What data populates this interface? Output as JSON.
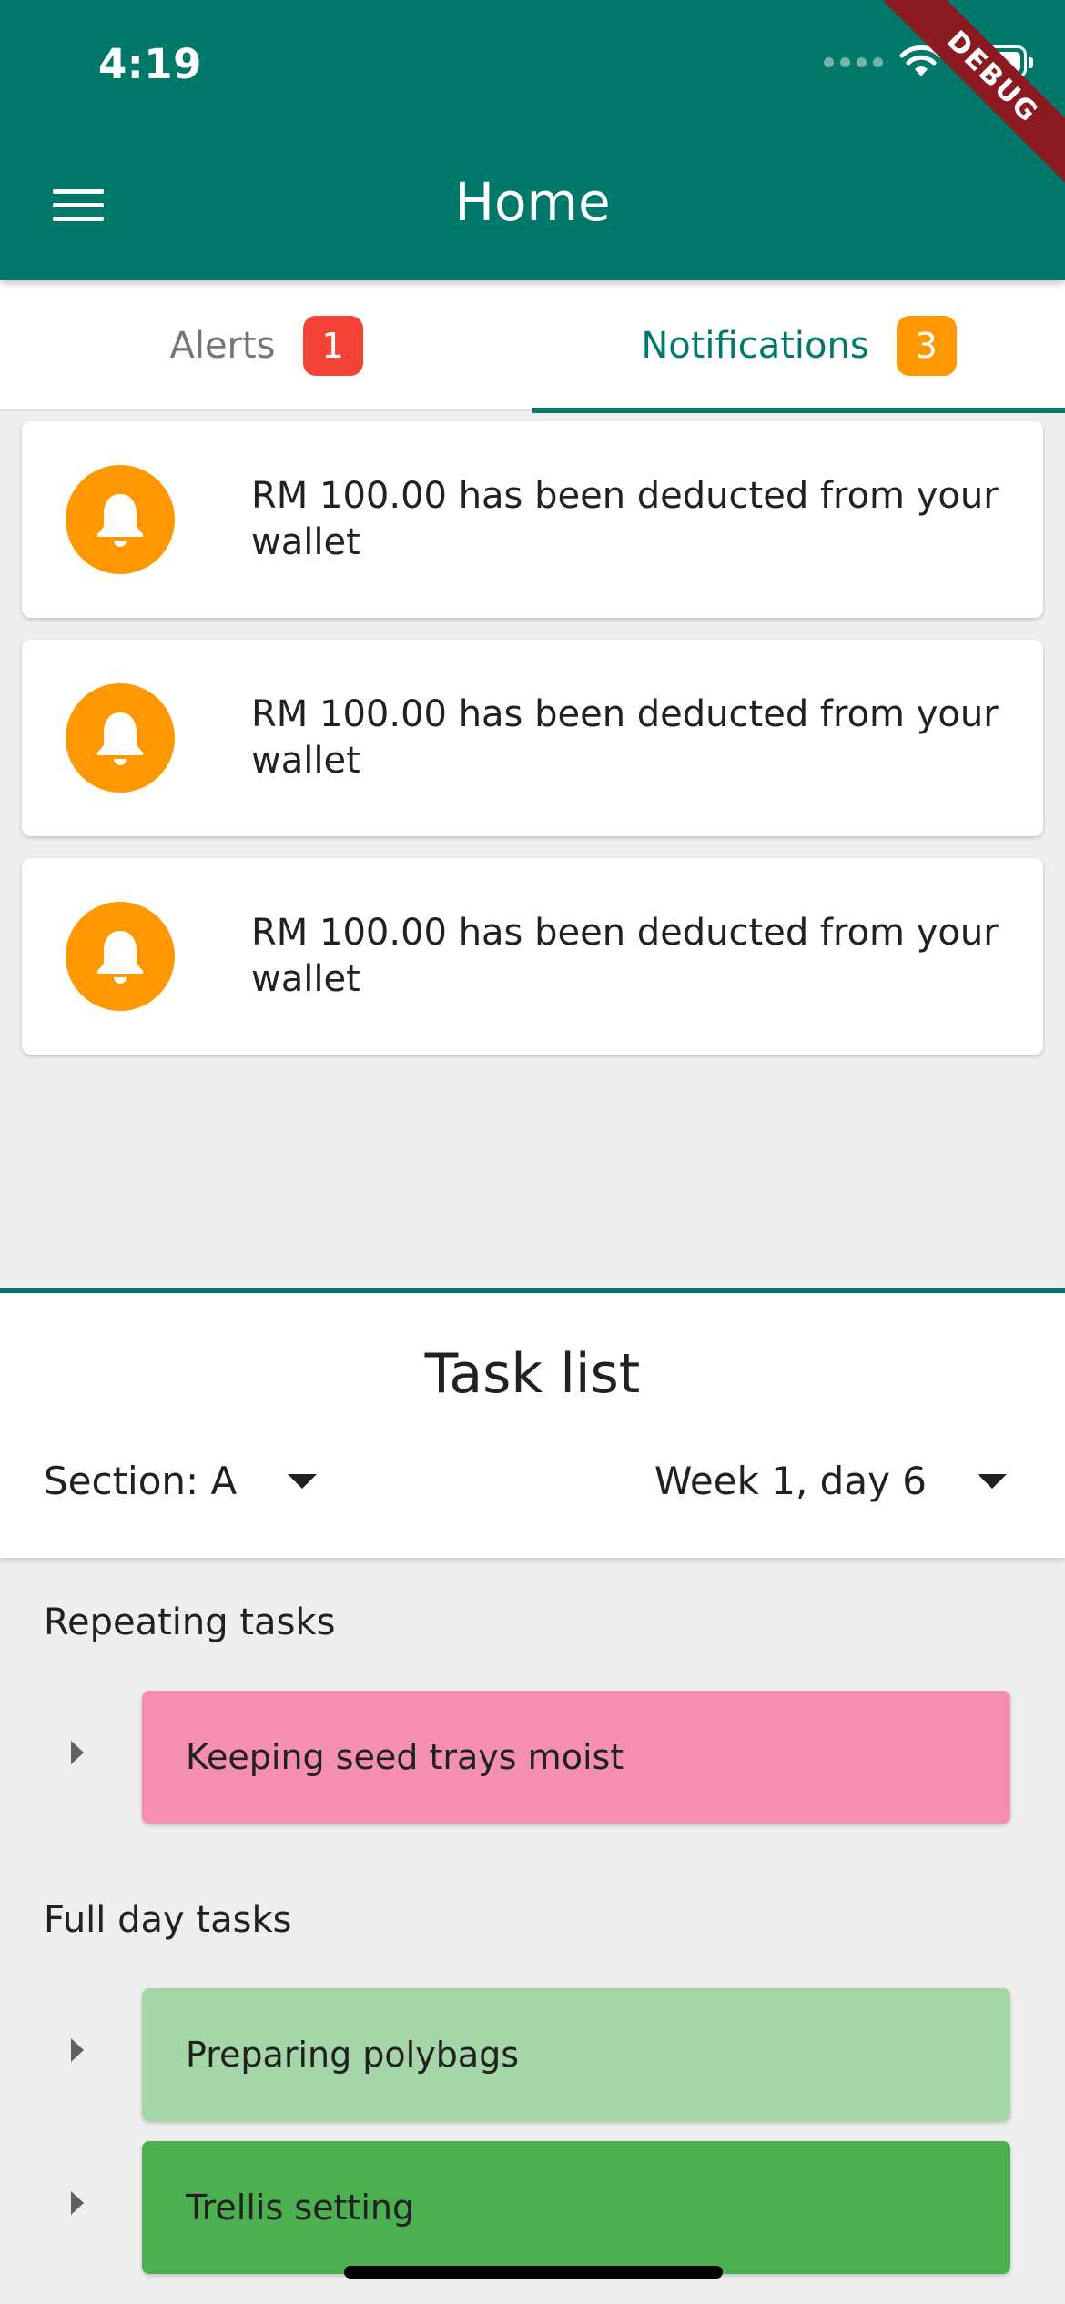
{
  "status_bar": {
    "time": "4:19",
    "debug_label": "DEBUG"
  },
  "app_bar": {
    "title": "Home"
  },
  "tabs": [
    {
      "label": "Alerts",
      "badge": "1",
      "badge_color": "#f44336",
      "selected": false
    },
    {
      "label": "Notifications",
      "badge": "3",
      "badge_color": "#ff9800",
      "selected": true
    }
  ],
  "notifications": [
    {
      "icon": "bell-icon",
      "text": "RM 100.00 has been deducted from your wallet"
    },
    {
      "icon": "bell-icon",
      "text": "RM 100.00 has been deducted from your wallet"
    },
    {
      "icon": "bell-icon",
      "text": "RM 100.00 has been deducted from your wallet"
    }
  ],
  "task_list": {
    "title": "Task list",
    "section_select": "Section: A",
    "week_select": "Week 1, day 6",
    "groups": [
      {
        "label": "Repeating tasks",
        "tasks": [
          {
            "label": "Keeping seed trays moist",
            "color": "#f48fb1"
          }
        ]
      },
      {
        "label": "Full day tasks",
        "tasks": [
          {
            "label": "Preparing polybags",
            "color": "#a5d6a7"
          },
          {
            "label": "Trellis setting",
            "color": "#4caf50"
          }
        ]
      }
    ]
  },
  "colors": {
    "primary": "#00796b",
    "accent": "#ff9800",
    "alert": "#f44336"
  }
}
